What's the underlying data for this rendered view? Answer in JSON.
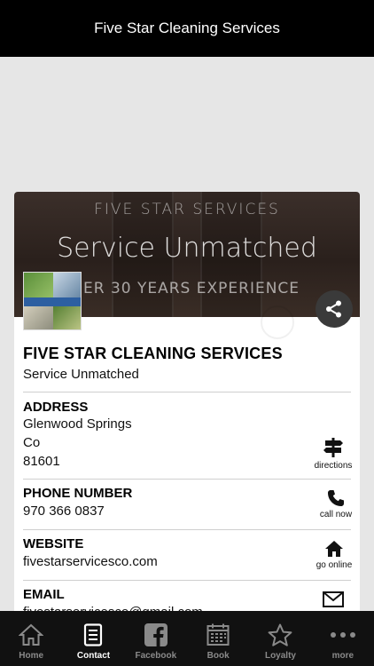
{
  "header": {
    "title": "Five Star Cleaning Services"
  },
  "banner": {
    "line1": "FIVE STAR SERVICES",
    "line2": "Service Unmatched",
    "line3": "ER 30 YEARS EXPERIENCE"
  },
  "business": {
    "name": "FIVE STAR CLEANING SERVICES",
    "tagline": "Service Unmatched"
  },
  "address": {
    "label": "ADDRESS",
    "line1": "Glenwood Springs",
    "line2": "Co",
    "line3": "81601",
    "action_label": "directions"
  },
  "phone": {
    "label": "PHONE NUMBER",
    "value": "970 366 0837",
    "action_label": "call now"
  },
  "website": {
    "label": "WEBSITE",
    "value": "fivestarservicesco.com",
    "action_label": "go online"
  },
  "email": {
    "label": "EMAIL",
    "value": "fivestarservicesco@gmail.com"
  },
  "tabs": [
    {
      "label": "Home",
      "icon": "home-icon",
      "active": false
    },
    {
      "label": "Contact",
      "icon": "contact-icon",
      "active": true
    },
    {
      "label": "Facebook",
      "icon": "facebook-icon",
      "active": false
    },
    {
      "label": "Book",
      "icon": "calendar-icon",
      "active": false
    },
    {
      "label": "Loyalty",
      "icon": "star-icon",
      "active": false
    },
    {
      "label": "more",
      "icon": "more-icon",
      "active": false
    }
  ]
}
